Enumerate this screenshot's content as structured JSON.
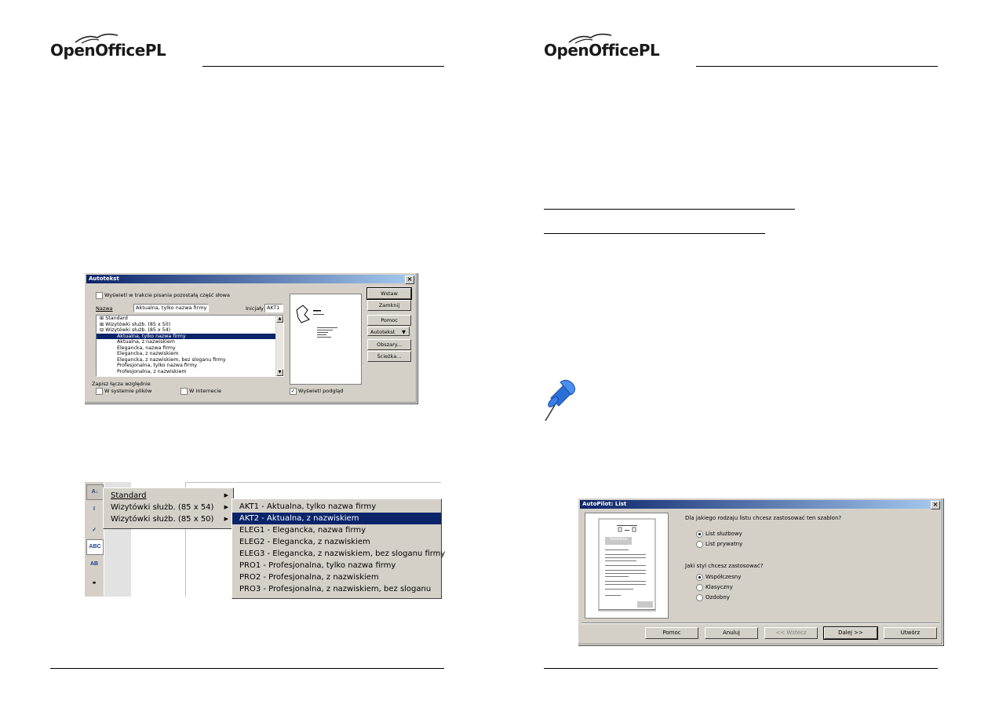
{
  "left_page": {
    "logo": {
      "open": "OpenOffice",
      "pl": "PL"
    },
    "autotekst_dialog": {
      "title": "Autotekst",
      "show_remainder_label": "Wyświetl w trakcie pisania pozostałą część słowa",
      "name_label": "Nazwa",
      "name_value": "Aktualna, tylko nazwa firmy",
      "initials_label": "Inicjały",
      "initials_value": "AKT1",
      "list_items": [
        "Standard",
        "Wizytówki służb. (85 x 50)",
        "Wizytówki służb. (85 x 54)",
        "Aktualna, tylko nazwa firmy",
        "Aktualna, z nazwiskiem",
        "Elegancka, nazwa firmy",
        "Elegancka, z nazwiskiem",
        "Elegancka, z nazwiskiem, bez sloganu firmy",
        "Profesjonalna, tylko nazwa firmy",
        "Profesjonalna, z nazwiskiem"
      ],
      "buttons": {
        "insert": "Wstaw",
        "close": "Zamknij",
        "help": "Pomoc",
        "autotext": "Autotekst",
        "categories": "Obszary...",
        "path": "Ścieżka..."
      },
      "save_relative_label": "Zapisz łącza względnie",
      "in_filesystem": "W systemie plików",
      "on_internet": "W Internecie",
      "show_preview": "Wyświetl podgląd"
    },
    "context_menu": {
      "items": [
        "Standard",
        "Wizytówki służb. (85 x 54)",
        "Wizytówki służb. (85 x 50)"
      ],
      "submenu": [
        "AKT1 - Aktualna, tylko nazwa firmy",
        "AKT2 - Aktualna, z nazwiskiem",
        "ELEG1 - Elegancka, nazwa firmy",
        "ELEG2 - Elegancka, z nazwiskiem",
        "ELEG3 - Elegancka, z nazwiskiem, bez sloganu firmy",
        "PRO1 - Profesjonalna, tylko nazwa firmy",
        "PRO2 - Profesjonalna, z nazwiskiem",
        "PRO3 - Profesjonalna, z nazwiskiem, bez sloganu"
      ]
    }
  },
  "right_page": {
    "logo": {
      "open": "OpenOffice",
      "pl": "PL"
    },
    "autopilot_dialog": {
      "title": "AutoPilot: List",
      "preview_label": "Osobista",
      "question1": "Dla jakiego rodzaju listu chcesz zastosować ten szablon?",
      "options1": [
        "List służbowy",
        "List prywatny"
      ],
      "question2": "Jaki styl chcesz zastosować?",
      "options2": [
        "Współczesny",
        "Klasyczny",
        "Ozdobny"
      ],
      "buttons": {
        "help": "Pomoc",
        "cancel": "Anuluj",
        "back": "<< Wstecz",
        "next": "Dalej >>",
        "create": "Utwórz"
      }
    }
  },
  "colors": {
    "titlebar": "#0a246a",
    "dialog": "#d4d0c8",
    "pin": "#2a6fd6"
  }
}
